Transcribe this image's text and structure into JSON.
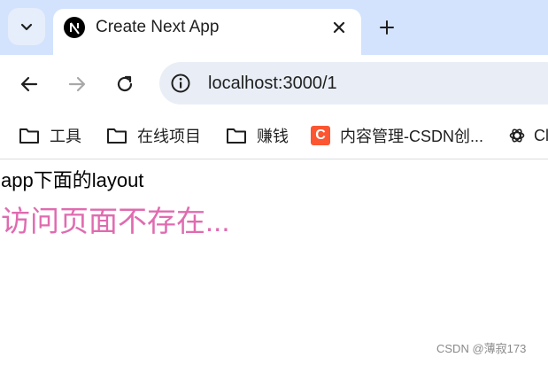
{
  "browser": {
    "tab": {
      "title": "Create Next App",
      "favicon": "nextjs-logo-icon"
    },
    "toolbar": {
      "url": "localhost:3000/1"
    },
    "bookmarks": [
      {
        "label": "工具",
        "icon": "folder-icon"
      },
      {
        "label": "在线项目",
        "icon": "folder-icon"
      },
      {
        "label": "赚钱",
        "icon": "folder-icon"
      },
      {
        "label": "内容管理-CSDN创...",
        "icon": "csdn-logo"
      },
      {
        "label": "Cl",
        "icon": "openai-icon"
      }
    ],
    "colors": {
      "tabstrip_bg": "#d3e3fd",
      "omnibox_bg": "#e9eef6",
      "csdn_brand": "#fc5531"
    }
  },
  "page": {
    "layout_text": "app下面的layout",
    "not_found_text": "访问页面不存在...",
    "not_found_color": "#e06bb0",
    "watermark": "CSDN @薄寂173"
  }
}
